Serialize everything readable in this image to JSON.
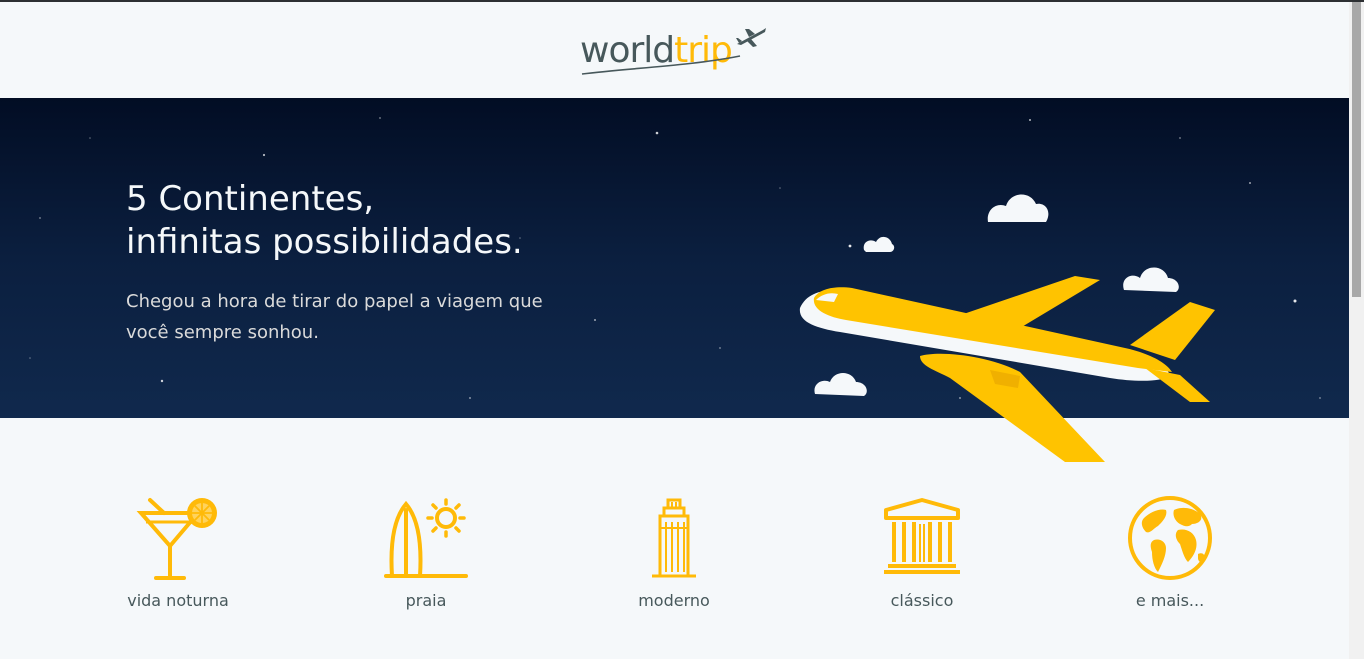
{
  "header": {
    "logo_world": "world",
    "logo_trip": "trip"
  },
  "banner": {
    "title_line1": "5 Continentes,",
    "title_line2": "infinitas possibilidades.",
    "subtitle_line1": "Chegou a hora de tirar do papel a viagem que",
    "subtitle_line2": "você sempre sonhou."
  },
  "travel_types": [
    {
      "label": "vida noturna",
      "icon": "cocktail-icon"
    },
    {
      "label": "praia",
      "icon": "surf-icon"
    },
    {
      "label": "moderno",
      "icon": "building-icon"
    },
    {
      "label": "clássico",
      "icon": "museum-icon"
    },
    {
      "label": "e mais...",
      "icon": "earth-icon"
    }
  ],
  "colors": {
    "accent": "#ffba08",
    "text_dark": "#47585b",
    "background": "#f5f8fa",
    "banner_top": "#020d24",
    "banner_bottom": "#10294d"
  }
}
